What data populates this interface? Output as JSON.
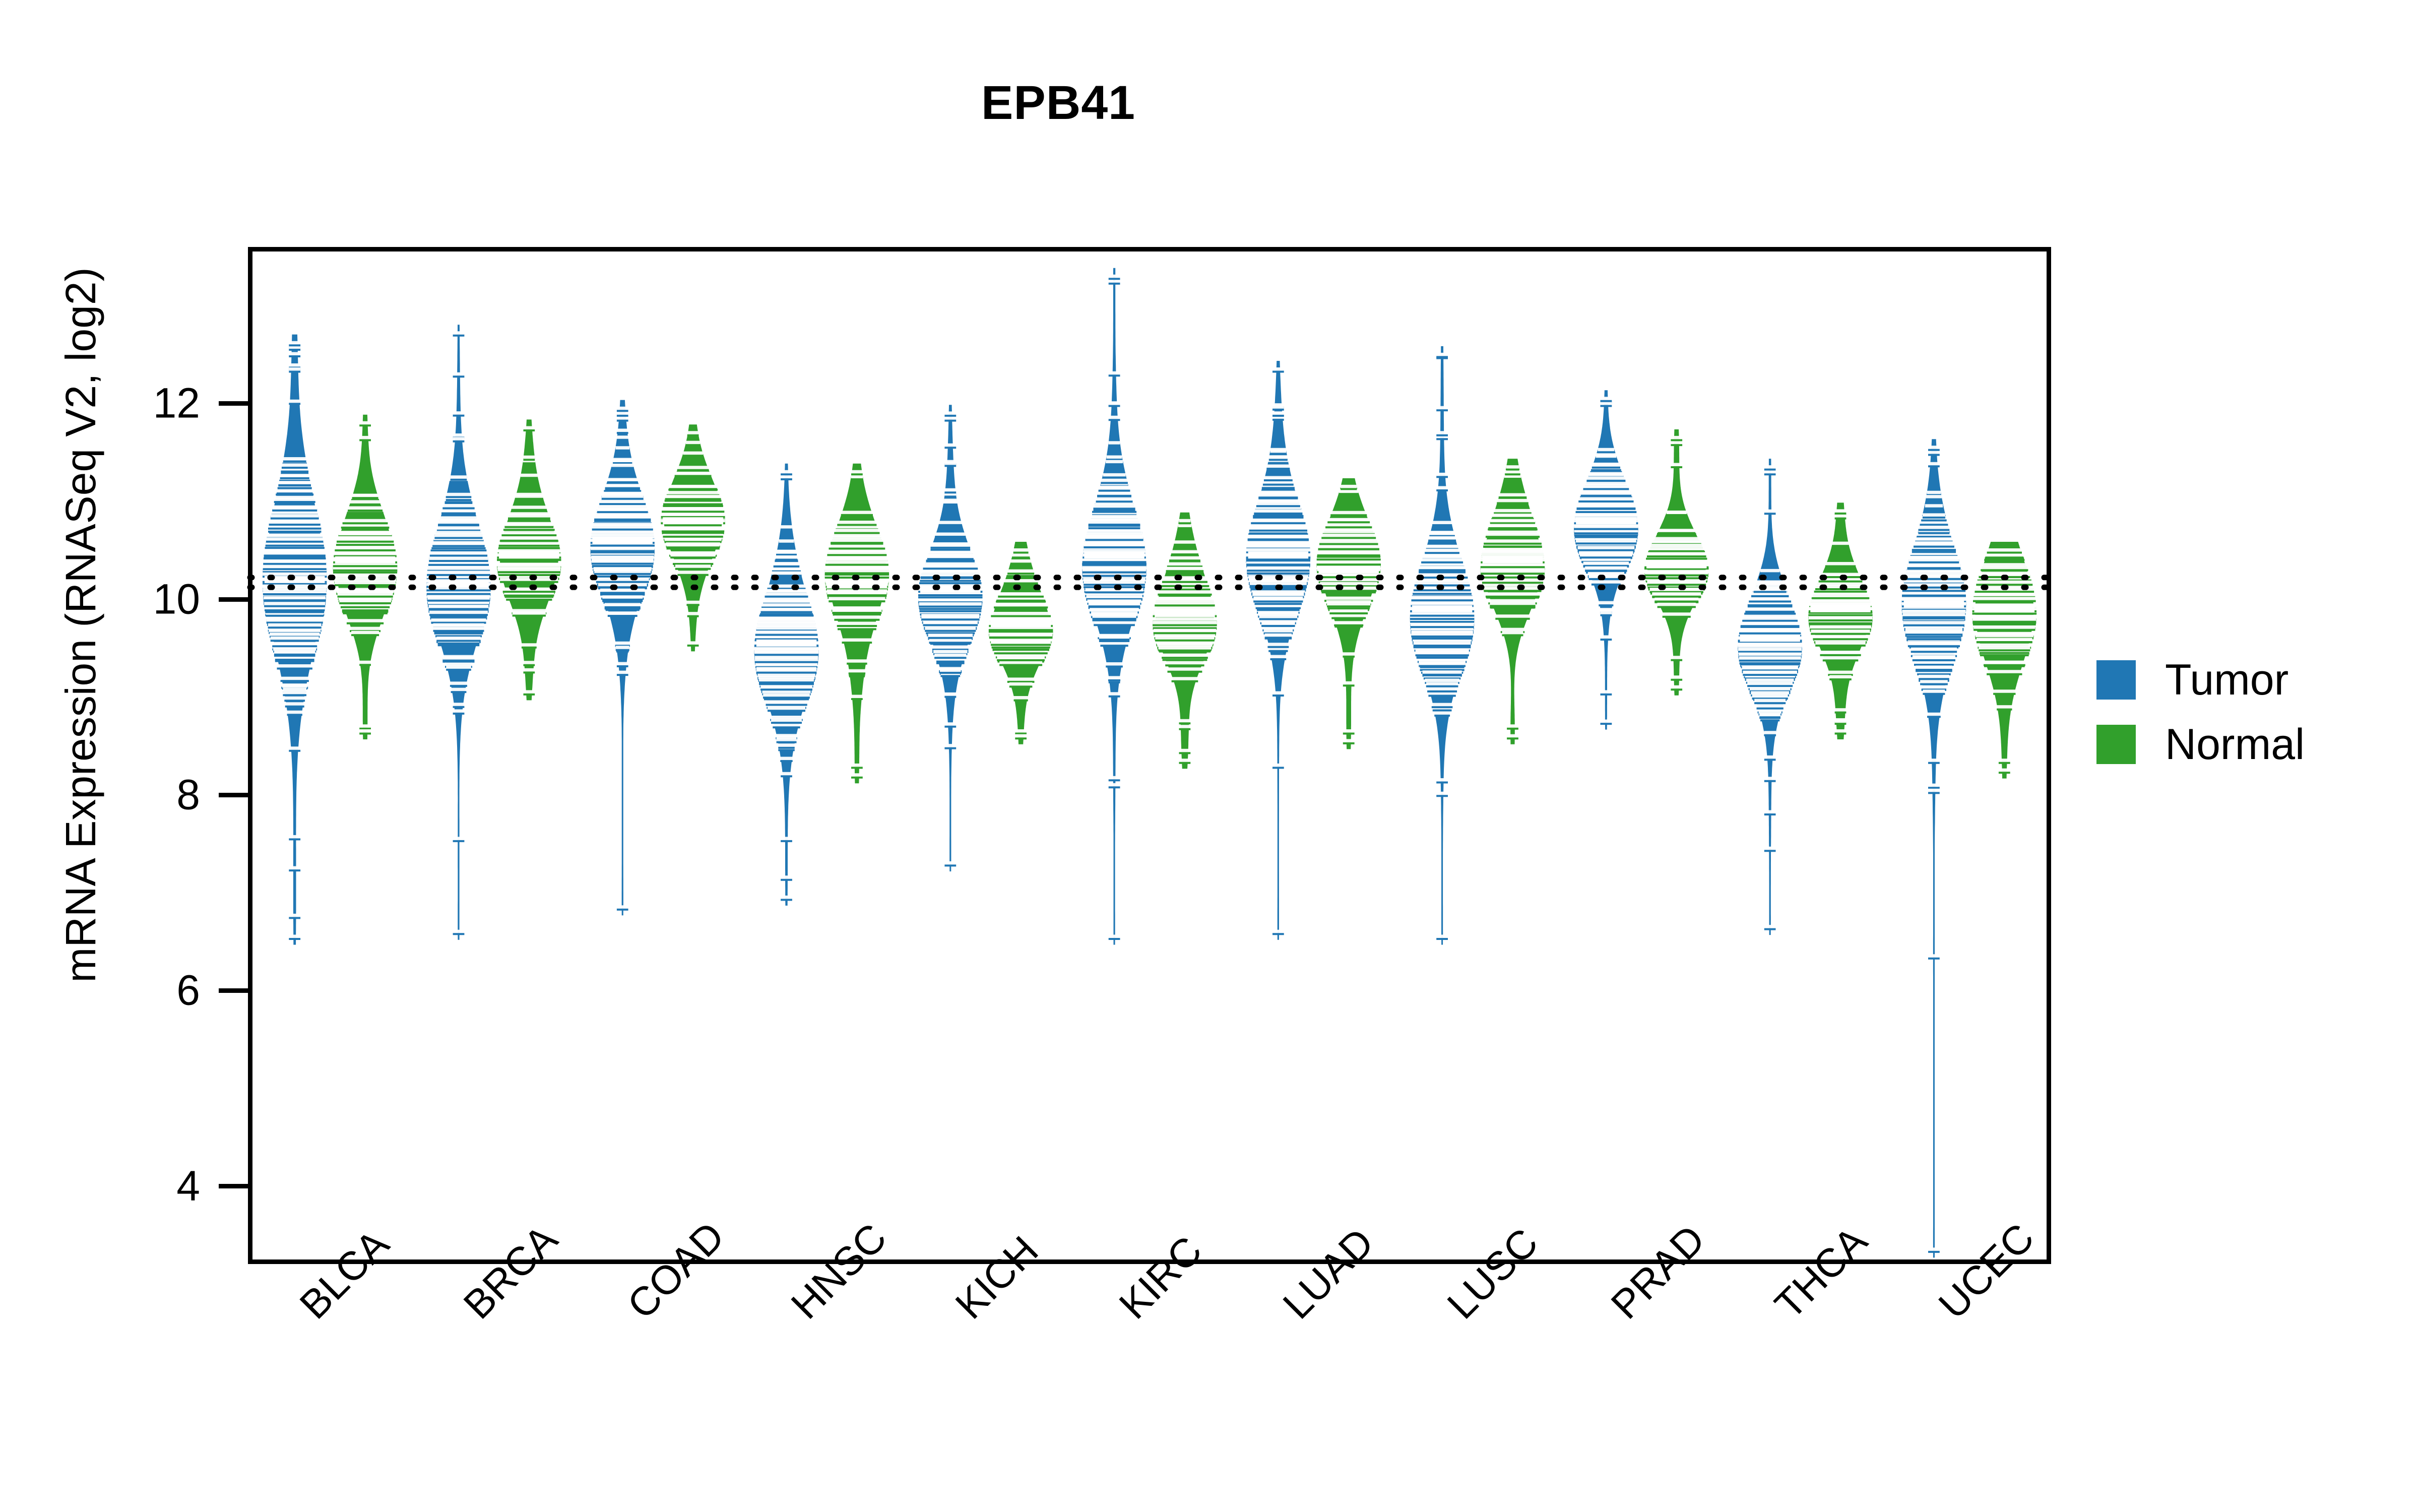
{
  "title": "EPB41",
  "axes": {
    "ylabel": "mRNA Expression (RNASeq V2, log2)",
    "yticks": [
      "4",
      "6",
      "8",
      "10",
      "12"
    ]
  },
  "legend": {
    "items": [
      {
        "label": "Tumor",
        "color": "#2077b4"
      },
      {
        "label": "Normal",
        "color": "#31a02c"
      }
    ]
  },
  "chart_data": {
    "type": "violin",
    "title": "EPB41",
    "xlabel": "",
    "ylabel": "mRNA Expression (RNASeq V2, log2)",
    "ylim": [
      3.2,
      13.6
    ],
    "yticks": [
      4,
      6,
      8,
      10,
      12
    ],
    "grid": false,
    "legend_position": "right",
    "group_colors": {
      "Tumor": "#2077b4",
      "Normal": "#31a02c"
    },
    "overall_mean_lines": [
      {
        "group": "Tumor",
        "value": 10.22,
        "style": "dotted",
        "color": "#000000"
      },
      {
        "group": "Normal",
        "value": 10.12,
        "style": "dotted",
        "color": "#000000"
      }
    ],
    "categories": [
      "BLCA",
      "BRCA",
      "COAD",
      "HNSC",
      "KICH",
      "KIRC",
      "LUAD",
      "LUSC",
      "PRAD",
      "THCA",
      "UCEC"
    ],
    "series": [
      {
        "name": "Tumor",
        "color": "#2077b4",
        "groups": [
          {
            "category": "BLCA",
            "median": 10.2,
            "q1": 9.6,
            "q3": 10.85,
            "min": 6.55,
            "max": 12.62,
            "density_peaks": [
              10.25
            ],
            "whisker_low": 7.25,
            "whisker_high": 12.35
          },
          {
            "category": "BRCA",
            "median": 10.15,
            "q1": 9.7,
            "q3": 10.65,
            "min": 6.6,
            "max": 12.72,
            "density_peaks": [
              10.15
            ],
            "whisker_low": 7.55,
            "whisker_high": 12.3
          },
          {
            "category": "COAD",
            "median": 10.6,
            "q1": 10.2,
            "q3": 11.05,
            "min": 6.85,
            "max": 11.95,
            "density_peaks": [
              10.65
            ],
            "whisker_low": 9.25,
            "whisker_high": 11.9
          },
          {
            "category": "HNSC",
            "median": 9.55,
            "q1": 9.1,
            "q3": 10.05,
            "min": 6.95,
            "max": 11.3,
            "density_peaks": [
              9.6
            ],
            "whisker_low": 7.55,
            "whisker_high": 11.25
          },
          {
            "category": "KICH",
            "median": 10.1,
            "q1": 9.7,
            "q3": 10.55,
            "min": 7.3,
            "max": 11.9,
            "density_peaks": [
              10.1
            ],
            "whisker_low": 8.5,
            "whisker_high": 11.85
          },
          {
            "category": "KIRC",
            "median": 10.45,
            "q1": 9.95,
            "q3": 10.95,
            "min": 6.55,
            "max": 13.3,
            "density_peaks": [
              10.45
            ],
            "whisker_low": 8.1,
            "whisker_high": 12.0
          },
          {
            "category": "LUAD",
            "median": 10.45,
            "q1": 10.0,
            "q3": 10.9,
            "min": 6.6,
            "max": 12.35,
            "density_peaks": [
              10.45
            ],
            "whisker_low": 8.3,
            "whisker_high": 11.9
          },
          {
            "category": "LUSC",
            "median": 9.9,
            "q1": 9.45,
            "q3": 10.4,
            "min": 6.55,
            "max": 12.5,
            "density_peaks": [
              9.9
            ],
            "whisker_low": 8.15,
            "whisker_high": 11.7
          },
          {
            "category": "PRAD",
            "median": 10.8,
            "q1": 10.45,
            "q3": 11.15,
            "min": 8.75,
            "max": 12.05,
            "density_peaks": [
              10.8
            ],
            "whisker_low": 9.05,
            "whisker_high": 12.0
          },
          {
            "category": "THCA",
            "median": 9.6,
            "q1": 9.25,
            "q3": 10.0,
            "min": 6.65,
            "max": 11.35,
            "density_peaks": [
              9.6
            ],
            "whisker_low": 7.45,
            "whisker_high": 11.3
          },
          {
            "category": "UCEC",
            "median": 9.95,
            "q1": 9.4,
            "q3": 10.4,
            "min": 3.35,
            "max": 11.55,
            "density_peaks": [
              9.95
            ],
            "whisker_low": 6.35,
            "whisker_high": 11.5
          }
        ]
      },
      {
        "name": "Normal",
        "color": "#31a02c",
        "groups": [
          {
            "category": "BLCA",
            "median": 10.4,
            "q1": 10.05,
            "q3": 10.8,
            "min": 8.65,
            "max": 11.8,
            "density_peaks": [
              10.45
            ],
            "whisker_low": 8.7,
            "whisker_high": 11.65
          },
          {
            "category": "BRCA",
            "median": 10.45,
            "q1": 10.1,
            "q3": 10.85,
            "min": 9.05,
            "max": 11.75,
            "density_peaks": [
              10.5
            ],
            "whisker_low": 9.35,
            "whisker_high": 11.45
          },
          {
            "category": "COAD",
            "median": 10.8,
            "q1": 10.45,
            "q3": 11.15,
            "min": 9.55,
            "max": 11.7,
            "density_peaks": [
              10.85
            ],
            "whisker_low": 9.85,
            "whisker_high": 11.6
          },
          {
            "category": "HNSC",
            "median": 10.15,
            "q1": 9.75,
            "q3": 10.6,
            "min": 8.2,
            "max": 11.3,
            "density_peaks": [
              10.2
            ],
            "whisker_low": 8.3,
            "whisker_high": 11.25
          },
          {
            "category": "KICH",
            "median": 9.75,
            "q1": 9.4,
            "q3": 10.05,
            "min": 8.6,
            "max": 10.5,
            "density_peaks": [
              9.8
            ],
            "whisker_low": 8.65,
            "whisker_high": 10.45
          },
          {
            "category": "KIRC",
            "median": 9.85,
            "q1": 9.5,
            "q3": 10.2,
            "min": 8.35,
            "max": 10.8,
            "density_peaks": [
              9.85
            ],
            "whisker_low": 8.45,
            "whisker_high": 10.75
          },
          {
            "category": "LUAD",
            "median": 10.3,
            "q1": 9.95,
            "q3": 10.65,
            "min": 8.55,
            "max": 11.15,
            "density_peaks": [
              10.3
            ],
            "whisker_low": 8.65,
            "whisker_high": 11.1
          },
          {
            "category": "LUSC",
            "median": 10.4,
            "q1": 10.05,
            "q3": 10.75,
            "min": 8.6,
            "max": 11.35,
            "density_peaks": [
              10.45
            ],
            "whisker_low": 8.7,
            "whisker_high": 11.3
          },
          {
            "category": "PRAD",
            "median": 10.35,
            "q1": 10.05,
            "q3": 10.7,
            "min": 9.1,
            "max": 11.65,
            "density_peaks": [
              10.35
            ],
            "whisker_low": 9.2,
            "whisker_high": 11.6
          },
          {
            "category": "THCA",
            "median": 9.9,
            "q1": 9.55,
            "q3": 10.25,
            "min": 8.65,
            "max": 10.9,
            "density_peaks": [
              9.9
            ],
            "whisker_low": 8.75,
            "whisker_high": 10.85
          },
          {
            "category": "UCEC",
            "median": 9.9,
            "q1": 9.35,
            "q3": 10.25,
            "min": 8.25,
            "max": 10.5,
            "density_peaks": [
              9.95
            ],
            "whisker_low": 8.35,
            "whisker_high": 10.45
          }
        ]
      }
    ]
  }
}
